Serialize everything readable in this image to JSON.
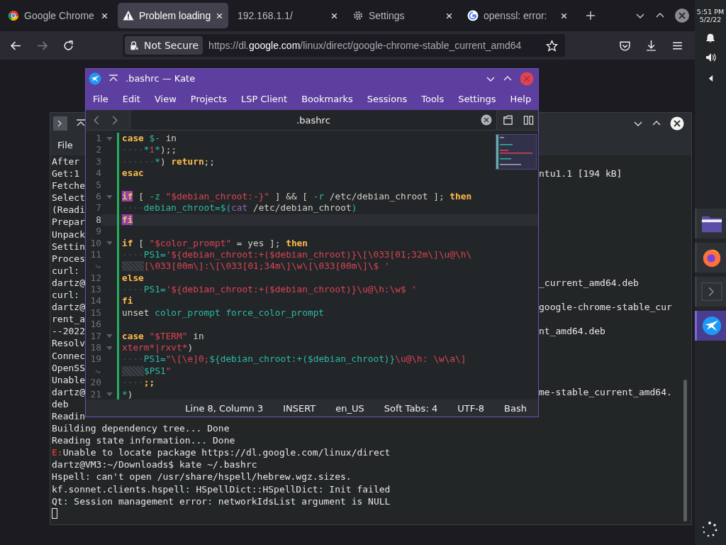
{
  "browser": {
    "tabs": [
      {
        "title": "Google Chrome",
        "kind": "chrome",
        "selected": false
      },
      {
        "title": "Problem loading",
        "kind": "warning",
        "selected": true
      },
      {
        "title": "192.168.1.1/",
        "kind": "none",
        "selected": false
      },
      {
        "title": "Settings",
        "kind": "gear",
        "selected": false
      },
      {
        "title": "openssl: error:",
        "kind": "google",
        "selected": false
      }
    ],
    "forward": {
      "disabled": true
    },
    "address": {
      "security": "Not Secure",
      "url": "https://dl.**google.com**/linux/direct/google-chrome-stable_current_amd64"
    }
  },
  "system_tray": {
    "time": "5:51 PM",
    "date": "5/2/22"
  },
  "dock": [
    {
      "kind": "folder",
      "selected": false
    },
    {
      "kind": "firefox",
      "selected": false
    },
    {
      "kind": "terminal",
      "selected": false
    },
    {
      "kind": "kate",
      "selected": true
    }
  ],
  "terminal": {
    "menu": [
      "File"
    ],
    "cursor_visible": true,
    "lines": [
      {
        "text": "After"
      },
      {
        "text": "Get:1",
        "right": "ntu1.1 [194 kB]"
      },
      {
        "text": "Fetche"
      },
      {
        "text": "Select"
      },
      {
        "text": "(Readi"
      },
      {
        "text": "Prepar"
      },
      {
        "text": "Unpack"
      },
      {
        "text": "Settin"
      },
      {
        "text": "Proces"
      },
      {
        "text": "curl:"
      },
      {
        "text": "dartz@",
        "right": "_current_amd64.deb"
      },
      {
        "text": "curl:"
      },
      {
        "text": "dartz@",
        "right": "google-chrome-stable_cur"
      },
      {
        "text": "rent_a"
      },
      {
        "text": "--2022",
        "right": "nt_amd64.deb"
      },
      {
        "text": "Resolv"
      },
      {
        "text": "Connec"
      },
      {
        "text": "OpenSS"
      },
      {
        "text": "Unable"
      },
      {
        "text": "dartz@",
        "right": "me-stable_current_amd64."
      },
      {
        "text": "deb"
      },
      {
        "text": "Readin"
      },
      {
        "text": "Building dependency tree... Done"
      },
      {
        "text": "Reading state information... Done"
      },
      {
        "prefix": "E:",
        "text": "Unable to locate package https://dl.google.com/linux/direct"
      },
      {
        "text": "dartz@VM3:~/Downloads$ kate ~/.bashrc"
      },
      {
        "text": "Hspell: can't open /usr/share/hspell/hebrew.wgz.sizes."
      },
      {
        "text": "kf.sonnet.clients.hspell: HSpellDict::HSpellDict: Init failed"
      },
      {
        "text": "Qt: Session management error: networkIdsList argument is NULL"
      }
    ]
  },
  "kate": {
    "title": ".bashrc — Kate",
    "menu": [
      "File",
      "Edit",
      "View",
      "Projects",
      "LSP Client",
      "Bookmarks",
      "Sessions",
      "Tools",
      "Settings",
      "Help"
    ],
    "tab": ".bashrc",
    "lines": [
      {
        "kind": "line",
        "number": "1",
        "fold": true,
        "current": false,
        "tokens": [
          {
            "kind": "kw",
            "text": "case"
          },
          {
            "kind": "var",
            "text": " $-"
          },
          {
            "kind": "plain",
            "text": " in"
          }
        ]
      },
      {
        "kind": "line",
        "number": "2",
        "fold": false,
        "current": false,
        "tokens": [
          {
            "kind": "ws",
            "text": "····"
          },
          {
            "kind": "var",
            "text": "*"
          },
          {
            "kind": "str",
            "text": "i"
          },
          {
            "kind": "var",
            "text": "*"
          },
          {
            "kind": "plain",
            "text": ");;"
          }
        ]
      },
      {
        "kind": "line",
        "number": "3",
        "fold": false,
        "current": false,
        "tokens": [
          {
            "kind": "ws",
            "text": "······"
          },
          {
            "kind": "var",
            "text": "*"
          },
          {
            "kind": "plain",
            "text": ") "
          },
          {
            "kind": "kw",
            "text": "return"
          },
          {
            "kind": "plain",
            "text": ";;"
          }
        ]
      },
      {
        "kind": "line",
        "number": "4",
        "fold": false,
        "current": false,
        "tokens": [
          {
            "kind": "kw",
            "text": "esac"
          }
        ]
      },
      {
        "kind": "line",
        "number": "5",
        "fold": false,
        "current": false
      },
      {
        "kind": "line",
        "number": "6",
        "fold": true,
        "current": false,
        "tokens": [
          {
            "kind": "match",
            "text": "if"
          },
          {
            "kind": "plain",
            "text": " [ "
          },
          {
            "kind": "var",
            "text": "-z"
          },
          {
            "kind": "str",
            "text": " \"$debian_chroot:-}\""
          },
          {
            "kind": "plain",
            "text": " ] && [ "
          },
          {
            "kind": "var",
            "text": "-r"
          },
          {
            "kind": "plain",
            "text": " /etc/debian_chroot ]; "
          },
          {
            "kind": "kw",
            "text": "then"
          }
        ]
      },
      {
        "kind": "line",
        "number": "7",
        "fold": false,
        "current": false,
        "tokens": [
          {
            "kind": "ws",
            "text": "····"
          },
          {
            "kind": "var",
            "text": "debian_chroot=$("
          },
          {
            "kind": "builtin",
            "text": "cat"
          },
          {
            "kind": "plain",
            "text": " /etc/debian_chroot"
          },
          {
            "kind": "var",
            "text": ")"
          }
        ]
      },
      {
        "kind": "line",
        "number": "8",
        "fold": false,
        "current": true,
        "tokens": [
          {
            "kind": "match",
            "text": "fi"
          }
        ]
      },
      {
        "kind": "line",
        "number": "9",
        "fold": false,
        "current": false
      },
      {
        "kind": "line",
        "number": "10",
        "fold": true,
        "current": false,
        "tokens": [
          {
            "kind": "kw",
            "text": "if"
          },
          {
            "kind": "plain",
            "text": " [ "
          },
          {
            "kind": "str",
            "text": "\"$color_prompt\""
          },
          {
            "kind": "plain",
            "text": " = yes ]; "
          },
          {
            "kind": "kw",
            "text": "then"
          }
        ]
      },
      {
        "kind": "line",
        "number": "11",
        "fold": false,
        "current": false,
        "tokens": [
          {
            "kind": "ws",
            "text": "····"
          },
          {
            "kind": "var",
            "text": "PS1="
          },
          {
            "kind": "str",
            "text": "'${debian_chroot:+($debian_chroot)}\\[\\033[01;32m\\]\\u@\\h\\"
          }
        ]
      },
      {
        "kind": "wrap",
        "tokens": [
          {
            "kind": "str",
            "text": "[\\033[00m\\]:\\[\\033[01;34m\\]\\w\\[\\033[00m\\]\\$ '"
          }
        ]
      },
      {
        "kind": "line",
        "number": "12",
        "fold": false,
        "current": false,
        "tokens": [
          {
            "kind": "kw",
            "text": "else"
          }
        ]
      },
      {
        "kind": "line",
        "number": "13",
        "fold": false,
        "current": false,
        "tokens": [
          {
            "kind": "ws",
            "text": "····"
          },
          {
            "kind": "var",
            "text": "PS1="
          },
          {
            "kind": "str",
            "text": "'${debian_chroot:+($debian_chroot)}\\u@\\h:\\w$ '"
          }
        ]
      },
      {
        "kind": "line",
        "number": "14",
        "fold": false,
        "current": false,
        "tokens": [
          {
            "kind": "kw",
            "text": "fi"
          }
        ]
      },
      {
        "kind": "line",
        "number": "15",
        "fold": false,
        "current": false,
        "tokens": [
          {
            "kind": "plain",
            "text": "unset "
          },
          {
            "kind": "var",
            "text": "color_prompt force_color_prompt"
          }
        ]
      },
      {
        "kind": "line",
        "number": "16",
        "fold": false,
        "current": false
      },
      {
        "kind": "line",
        "number": "17",
        "fold": true,
        "current": false,
        "tokens": [
          {
            "kind": "kw",
            "text": "case"
          },
          {
            "kind": "str",
            "text": " \"$TERM\""
          },
          {
            "kind": "plain",
            "text": " in"
          }
        ]
      },
      {
        "kind": "line",
        "number": "18",
        "fold": true,
        "current": false,
        "tokens": [
          {
            "kind": "str",
            "text": "xterm*|rxvt*"
          },
          {
            "kind": "plain",
            "text": ")"
          }
        ]
      },
      {
        "kind": "line",
        "number": "19",
        "fold": false,
        "current": false,
        "tokens": [
          {
            "kind": "ws",
            "text": "····"
          },
          {
            "kind": "var",
            "text": "PS1="
          },
          {
            "kind": "str",
            "text": "\"\\[\\e]0;"
          },
          {
            "kind": "var",
            "text": "${debian_chroot:+($debian_chroot)}"
          },
          {
            "kind": "str",
            "text": "\\u@\\h: \\w\\a\\]"
          }
        ]
      },
      {
        "kind": "wrap",
        "tokens": [
          {
            "kind": "var",
            "text": "$PS1"
          },
          {
            "kind": "str",
            "text": "\""
          }
        ]
      },
      {
        "kind": "line",
        "number": "20",
        "fold": false,
        "current": false,
        "tokens": [
          {
            "kind": "ws",
            "text": "····"
          },
          {
            "kind": "kw",
            "text": ";;"
          }
        ]
      },
      {
        "kind": "line",
        "number": "21",
        "fold": true,
        "current": false,
        "tokens": [
          {
            "kind": "var",
            "text": "*"
          },
          {
            "kind": "plain",
            "text": ")"
          }
        ]
      }
    ],
    "status": [
      "Line 8, Column 3",
      "INSERT",
      "en_US",
      "Soft Tabs: 4",
      "UTF-8",
      "Bash"
    ]
  }
}
